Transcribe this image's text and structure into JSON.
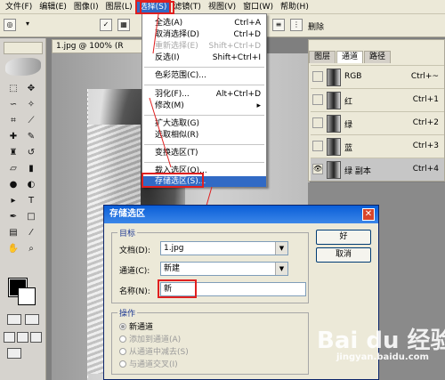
{
  "menubar": {
    "items": [
      "文件(F)",
      "编辑(E)",
      "图像(I)",
      "图层(L)",
      "选择(S)",
      "滤镜(T)",
      "视图(V)",
      "窗口(W)",
      "帮助(H)"
    ]
  },
  "optbar": {
    "delete_label": "删除"
  },
  "document": {
    "tab": "1.jpg @ 100% (R"
  },
  "select_menu": {
    "items": [
      {
        "label": "全选(A)",
        "shortcut": "Ctrl+A",
        "disabled": false
      },
      {
        "label": "取消选择(D)",
        "shortcut": "Ctrl+D",
        "disabled": false
      },
      {
        "label": "重新选择(E)",
        "shortcut": "Shift+Ctrl+D",
        "disabled": true
      },
      {
        "label": "反选(I)",
        "shortcut": "Shift+Ctrl+I",
        "disabled": false
      },
      {
        "label": "色彩范围(C)...",
        "shortcut": "",
        "disabled": false
      },
      {
        "label": "羽化(F)...",
        "shortcut": "Alt+Ctrl+D",
        "disabled": false
      },
      {
        "label": "修改(M)",
        "shortcut": "",
        "disabled": false
      },
      {
        "label": "扩大选取(G)",
        "shortcut": "",
        "disabled": false
      },
      {
        "label": "选取相似(R)",
        "shortcut": "",
        "disabled": false
      },
      {
        "label": "变换选区(T)",
        "shortcut": "",
        "disabled": false
      },
      {
        "label": "载入选区(O)...",
        "shortcut": "",
        "disabled": false
      },
      {
        "label": "存储选区(S)...",
        "shortcut": "",
        "disabled": false
      }
    ]
  },
  "channels_panel": {
    "tabs": [
      "图层",
      "通道",
      "路径"
    ],
    "rows": [
      {
        "name": "RGB",
        "shortcut": "Ctrl+~"
      },
      {
        "name": "红",
        "shortcut": "Ctrl+1"
      },
      {
        "name": "绿",
        "shortcut": "Ctrl+2"
      },
      {
        "name": "蓝",
        "shortcut": "Ctrl+3"
      },
      {
        "name": "绿 副本",
        "shortcut": "Ctrl+4"
      }
    ]
  },
  "dialog": {
    "title": "存储选区",
    "close": "✕",
    "target_group": "目标",
    "doc_label": "文档(D):",
    "doc_value": "1.jpg",
    "channel_label": "通道(C):",
    "channel_value": "新建",
    "name_label": "名称(N):",
    "name_value": "新",
    "ok": "好",
    "cancel": "取消",
    "operation_group": "操作",
    "operations": [
      "新通道",
      "添加到通道(A)",
      "从通道中减去(S)",
      "与通道交叉(I)"
    ]
  },
  "watermark": {
    "logo": "Bai du 经验",
    "url": "jingyan.baidu.com"
  }
}
